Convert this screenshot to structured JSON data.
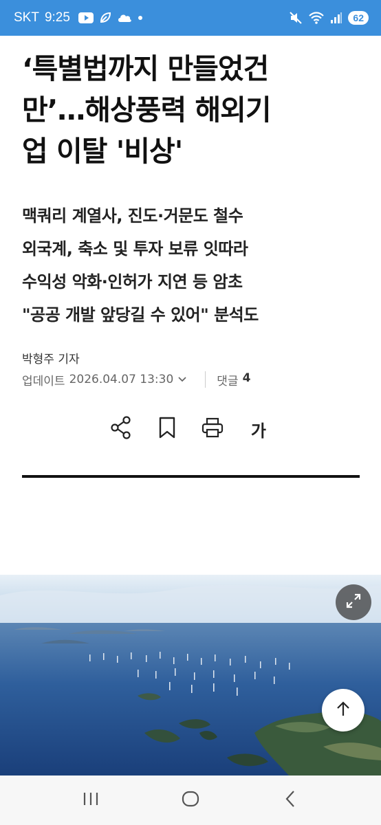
{
  "status_bar": {
    "carrier": "SKT",
    "time": "9:25",
    "battery": "62"
  },
  "article": {
    "headline": "‘특별법까지 만들었건만’…해상풍력 해외기업 이탈 '비상'",
    "headline_lines": [
      "‘특별법까지 만들었건",
      "만’…해상풍력 해외기",
      "업 이탈 '비상'"
    ],
    "subtitle_lines": [
      "맥쿼리 계열사, 진도·거문도 철수",
      "외국계, 축소 및 투자 보류 잇따라",
      "수익성 악화·인허가 지연 등 암초",
      "\"공공 개발 앞당길 수 있어\" 분석도"
    ],
    "byline": "박형주 기자",
    "update_label": "업데이트",
    "update_time": "2026.04.07 13:30",
    "comments_label": "댓글",
    "comments_count": "4",
    "font_size_label": "가"
  },
  "icons": {
    "share": "share-icon",
    "bookmark": "bookmark-icon",
    "print": "print-icon",
    "expand": "expand-icon",
    "scroll_top": "arrow-up-icon"
  },
  "colors": {
    "status_bar": "#3b8fdc",
    "text": "#111111",
    "muted": "#666666"
  }
}
